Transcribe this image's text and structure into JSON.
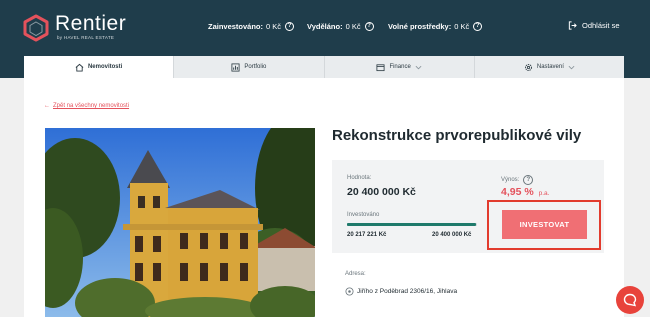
{
  "brand": {
    "name": "Rentier",
    "tagline": "by HAVEL REAL ESTATE",
    "accent_color": "#e4525c",
    "header_color": "#1f3d4b"
  },
  "header": {
    "stats": [
      {
        "label": "Zainvestováno:",
        "value": "0 Kč",
        "icon": "question-icon"
      },
      {
        "label": "Vyděláno:",
        "value": "0 Kč",
        "icon": "question-icon"
      },
      {
        "label": "Volné prostředky:",
        "value": "0 Kč",
        "icon": "question-icon"
      }
    ],
    "logout_label": "Odhlásit se"
  },
  "tabs": [
    {
      "label": "Nemovitosti",
      "icon": "home-icon",
      "active": true
    },
    {
      "label": "Portfolio",
      "icon": "bar-chart-icon",
      "active": false
    },
    {
      "label": "Finance",
      "icon": "wallet-icon",
      "active": false,
      "dropdown": true
    },
    {
      "label": "Nastavení",
      "icon": "gear-icon",
      "active": false,
      "dropdown": true
    }
  ],
  "back_link": {
    "arrow": "←",
    "label": "Zpět na všechny nemovitosti"
  },
  "property": {
    "title": "Rekonstrukce prvorepublikové vily",
    "value_label": "Hodnota:",
    "value": "20 400 000 Kč",
    "yield_label": "Výnos:",
    "yield_value": "4,95 %",
    "yield_unit": "p.a.",
    "invested_label": "Investováno",
    "invested_amount": "20 217 221 Kč",
    "target_amount": "20 400 000 Kč",
    "invested_fraction": 0.991,
    "invest_button": "INVESTOVAT",
    "address_label": "Adresa:",
    "address": "Jiřího z Poděbrad 2306/16, Jihlava"
  }
}
